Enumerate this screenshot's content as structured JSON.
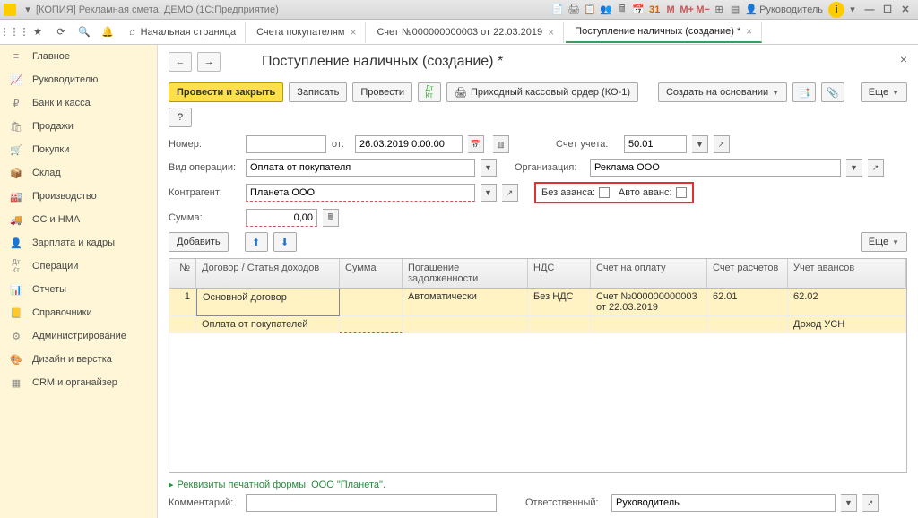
{
  "titlebar": {
    "text": "[КОПИЯ] Рекламная смета: ДЕМО  (1С:Предприятие)",
    "user": "Руководитель"
  },
  "tabs": {
    "home": "Начальная страница",
    "t1": "Счета покупателям",
    "t2": "Счет №000000000003 от 22.03.2019",
    "t3": "Поступление наличных (создание) *"
  },
  "sidebar": [
    "Главное",
    "Руководителю",
    "Банк и касса",
    "Продажи",
    "Покупки",
    "Склад",
    "Производство",
    "ОС и НМА",
    "Зарплата и кадры",
    "Операции",
    "Отчеты",
    "Справочники",
    "Администрирование",
    "Дизайн и верстка",
    "CRM и органайзер"
  ],
  "page": {
    "title": "Поступление наличных (создание) *"
  },
  "cmd": {
    "post_close": "Провести и закрыть",
    "write": "Записать",
    "post": "Провести",
    "print": "Приходный кассовый ордер (КО-1)",
    "create_based": "Создать на основании",
    "more": "Еще",
    "help": "?",
    "add": "Добавить"
  },
  "form": {
    "number_lbl": "Номер:",
    "number": "",
    "date_lbl": "от:",
    "date": "26.03.2019 0:00:00",
    "account_lbl": "Счет учета:",
    "account": "50.01",
    "optype_lbl": "Вид операции:",
    "optype": "Оплата от покупателя",
    "org_lbl": "Организация:",
    "org": "Реклама ООО",
    "contr_lbl": "Контрагент:",
    "contr": "Планета ООО",
    "noadv_lbl": "Без аванса:",
    "autoadv_lbl": "Авто аванс:",
    "sum_lbl": "Сумма:",
    "sum": "0,00",
    "comment_lbl": "Комментарий:",
    "comment": "",
    "resp_lbl": "Ответственный:",
    "resp": "Руководитель"
  },
  "table": {
    "headers": {
      "n": "№",
      "d": "Договор / Статья доходов",
      "s": "Сумма",
      "p": "Погашение задолженности",
      "nds": "НДС",
      "so": "Счет на оплату",
      "sr": "Счет расчетов",
      "ua": "Учет авансов"
    },
    "row1": {
      "n": "1",
      "d": "Основной договор",
      "s": "",
      "p": "Автоматически",
      "nds": "Без НДС",
      "so": "Счет №000000000003 от 22.03.2019",
      "sr": "62.01",
      "ua": "62.02"
    },
    "row2": {
      "d": "Оплата от покупателей",
      "ua": "Доход УСН"
    }
  },
  "footer_link": "Реквизиты печатной формы: ООО \"Планета\"."
}
